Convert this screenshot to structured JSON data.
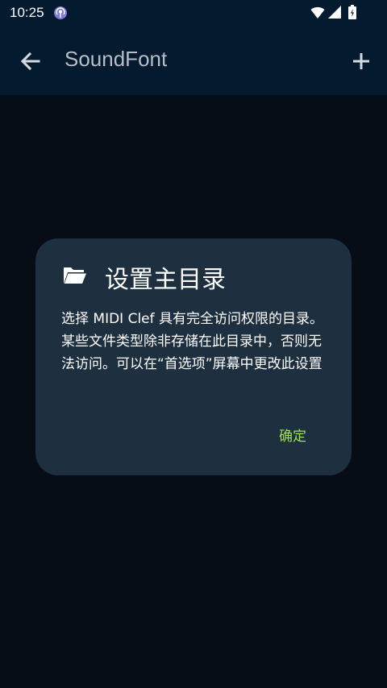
{
  "status_bar": {
    "time": "10:25",
    "icons": [
      "podcast-icon",
      "wifi-icon",
      "signal-icon",
      "battery-icon"
    ]
  },
  "app_bar": {
    "title": "SoundFont",
    "back_icon": "arrow-left-icon",
    "add_icon": "plus-icon"
  },
  "dialog": {
    "icon": "folder-open-icon",
    "title": "设置主目录",
    "message": "选择 MIDI Clef 具有完全访问权限的目录。某些文件类型除非存储在此目录中，否则无法访问。可以在“首选项”屏幕中更改此设置",
    "ok_label": "确定"
  },
  "colors": {
    "app_bar_bg": "#031a2f",
    "content_bg": "#070d16",
    "dialog_bg": "#1e2f40",
    "accent": "#9fe34a"
  }
}
